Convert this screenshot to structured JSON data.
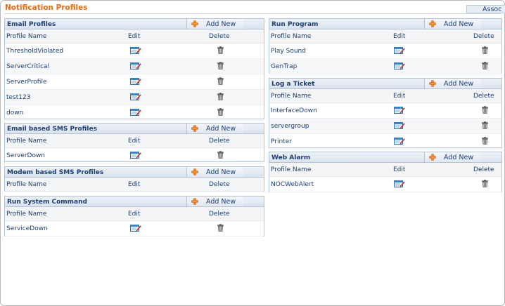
{
  "page": {
    "title": "Notification Profiles",
    "assoc_tab": "Assoc"
  },
  "colors": {
    "title": "#e86b12",
    "header_text": "#1e3f73",
    "border": "#b3c3d8"
  },
  "columns": {
    "name": "Profile Name",
    "edit": "Edit",
    "delete": "Delete"
  },
  "add_label": "Add New",
  "panels": {
    "email": {
      "title": "Email Profiles",
      "rows": [
        "ThresholdViolated",
        "ServerCritical",
        "ServerProfile",
        "test123",
        "down"
      ]
    },
    "email_sms": {
      "title": "Email based SMS Profiles",
      "rows": [
        "ServerDown"
      ]
    },
    "modem_sms": {
      "title": "Modem based SMS Profiles",
      "rows": []
    },
    "run_system": {
      "title": "Run System Command",
      "rows": [
        "ServiceDown"
      ]
    },
    "run_program": {
      "title": "Run Program",
      "rows": [
        "Play Sound",
        "GenTrap"
      ]
    },
    "log_ticket": {
      "title": "Log a Ticket",
      "rows": [
        "InterfaceDown",
        "servergroup",
        "Printer"
      ]
    },
    "web_alarm": {
      "title": "Web Alarm",
      "rows": [
        "NOCWebAlert"
      ]
    }
  },
  "icons": {
    "add": "add-plus-icon",
    "edit": "edit-pencil-icon",
    "delete": "delete-trash-icon"
  }
}
